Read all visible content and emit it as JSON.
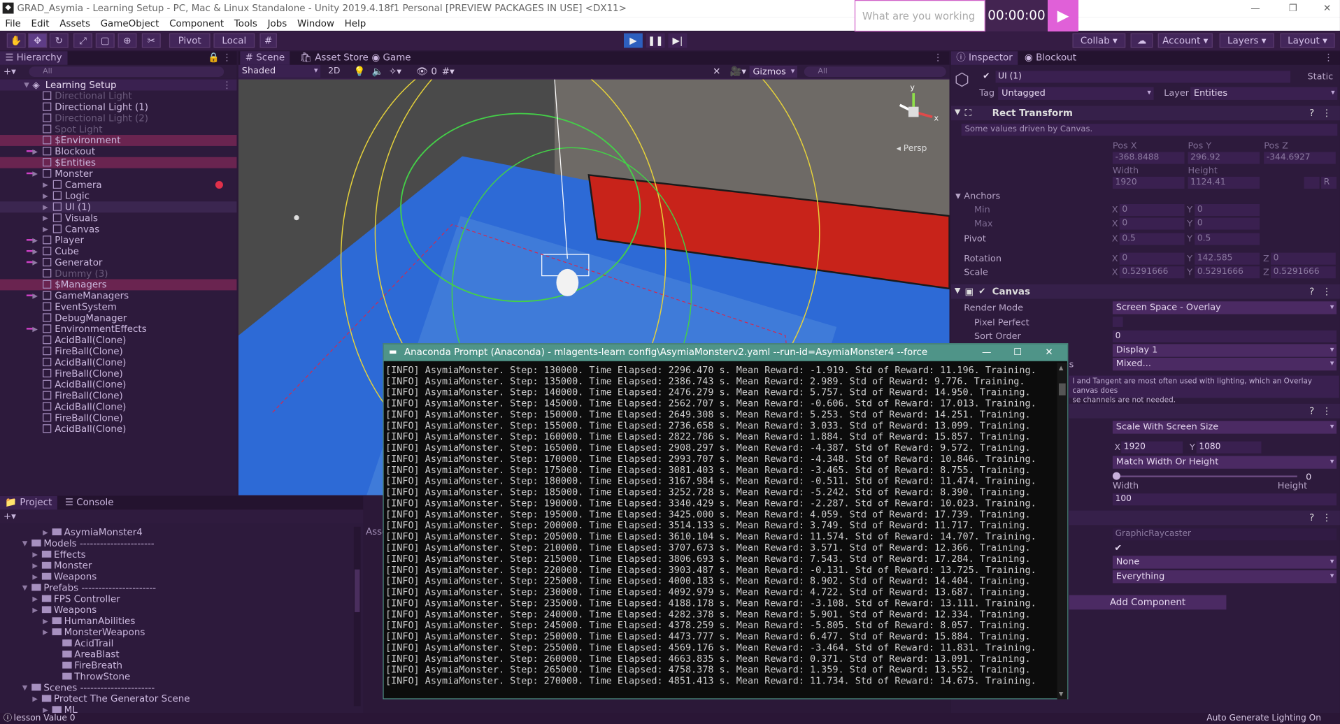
{
  "window": {
    "title": "GRAD_Asymia - Learning Setup - PC, Mac & Linux Standalone - Unity 2019.4.18f1 Personal [PREVIEW PACKAGES IN USE] <DX11>",
    "search_placeholder": "What are you working on?",
    "timer": "00:00:00"
  },
  "menu": [
    "File",
    "Edit",
    "Assets",
    "GameObject",
    "Component",
    "Tools",
    "Jobs",
    "Window",
    "Help"
  ],
  "toolbar": {
    "pivot": "Pivot",
    "local": "Local",
    "collab": "Collab",
    "account": "Account",
    "layers": "Layers",
    "layout": "Layout"
  },
  "hierarchy": {
    "tab": "Hierarchy",
    "search_placeholder": "All",
    "scene": "Learning Setup",
    "items": [
      {
        "label": "Directional Light",
        "style": "dim"
      },
      {
        "label": "Directional Light (1)",
        "style": "normal"
      },
      {
        "label": "Directional Light (2)",
        "style": "dim"
      },
      {
        "label": "Spot Light",
        "style": "dim"
      },
      {
        "label": "$Environment",
        "style": "hl"
      },
      {
        "label": "Blockout",
        "style": "normal"
      },
      {
        "label": "$Entities",
        "style": "hl"
      },
      {
        "label": "Monster",
        "style": "normal"
      },
      {
        "label": "Camera",
        "style": "child"
      },
      {
        "label": "Logic",
        "style": "child"
      },
      {
        "label": "UI (1)",
        "style": "childsel"
      },
      {
        "label": "Visuals",
        "style": "child"
      },
      {
        "label": "Canvas",
        "style": "child"
      },
      {
        "label": "Player",
        "style": "normal"
      },
      {
        "label": "Cube",
        "style": "normal"
      },
      {
        "label": "Generator",
        "style": "normal"
      },
      {
        "label": "Dummy (3)",
        "style": "dim"
      },
      {
        "label": "$Managers",
        "style": "hl"
      },
      {
        "label": "GameManagers",
        "style": "normal"
      },
      {
        "label": "EventSystem",
        "style": "normal"
      },
      {
        "label": "DebugManager",
        "style": "normal"
      },
      {
        "label": "EnvironmentEffects",
        "style": "normal"
      },
      {
        "label": "AcidBall(Clone)",
        "style": "normal"
      },
      {
        "label": "FireBall(Clone)",
        "style": "normal"
      },
      {
        "label": "AcidBall(Clone)",
        "style": "normal"
      },
      {
        "label": "FireBall(Clone)",
        "style": "normal"
      },
      {
        "label": "AcidBall(Clone)",
        "style": "normal"
      },
      {
        "label": "FireBall(Clone)",
        "style": "normal"
      },
      {
        "label": "AcidBall(Clone)",
        "style": "normal"
      },
      {
        "label": "FireBall(Clone)",
        "style": "normal"
      },
      {
        "label": "AcidBall(Clone)",
        "style": "normal"
      }
    ]
  },
  "scene": {
    "tabs": [
      "Scene",
      "Asset Store",
      "Game"
    ],
    "shading": "Shaded",
    "twod": "2D",
    "fx_count": "0",
    "gizmos": "Gizmos",
    "search_placeholder": "All",
    "persp": "Persp",
    "axis_x": "x",
    "axis_y": "y"
  },
  "project": {
    "tabs": [
      "Project",
      "Console"
    ],
    "partial_label": "Asse",
    "partial_label2": "Ac",
    "tree": [
      {
        "label": "AsymiaMonster4",
        "depth": 3,
        "sep": false
      },
      {
        "label": "Models",
        "depth": 1,
        "sep": true
      },
      {
        "label": "Effects",
        "depth": 2,
        "sep": false
      },
      {
        "label": "Monster",
        "depth": 2,
        "sep": false
      },
      {
        "label": "Weapons",
        "depth": 2,
        "sep": false
      },
      {
        "label": "Prefabs",
        "depth": 1,
        "sep": true
      },
      {
        "label": "FPS Controller",
        "depth": 2,
        "sep": false
      },
      {
        "label": "Weapons",
        "depth": 2,
        "sep": false
      },
      {
        "label": "HumanAbilities",
        "depth": 3,
        "sep": false
      },
      {
        "label": "MonsterWeapons",
        "depth": 3,
        "sep": false
      },
      {
        "label": "AcidTrail",
        "depth": 4,
        "sep": false
      },
      {
        "label": "AreaBlast",
        "depth": 4,
        "sep": false
      },
      {
        "label": "FireBreath",
        "depth": 4,
        "sep": false
      },
      {
        "label": "ThrowStone",
        "depth": 4,
        "sep": false
      },
      {
        "label": "Scenes",
        "depth": 1,
        "sep": true
      },
      {
        "label": "Protect The Generator Scene",
        "depth": 2,
        "sep": false
      },
      {
        "label": "ML",
        "depth": 3,
        "sep": false
      }
    ]
  },
  "inspector": {
    "tabs": [
      "Inspector",
      "Blockout"
    ],
    "object_name": "UI (1)",
    "static": "Static",
    "tag_label": "Tag",
    "tag": "Untagged",
    "layer_label": "Layer",
    "layer": "Entities",
    "rect_transform": "Rect Transform",
    "driven_note": "Some values driven by Canvas.",
    "pos_headers": [
      "Pos X",
      "Pos Y",
      "Pos Z"
    ],
    "pos_values": [
      "-368.8488",
      "296.92",
      "-344.6927"
    ],
    "size_headers": [
      "Width",
      "Height"
    ],
    "size_values": [
      "1920",
      "1124.41"
    ],
    "anchors": "Anchors",
    "min": "Min",
    "max": "Max",
    "anchor_min": [
      "0",
      "0"
    ],
    "anchor_max": [
      "0",
      "0"
    ],
    "pivot_label": "Pivot",
    "pivot": [
      "0.5",
      "0.5"
    ],
    "rotation_label": "Rotation",
    "rotation": [
      "0",
      "142.585",
      "0"
    ],
    "scale_label": "Scale",
    "scale": [
      "0.5291666",
      "0.5291666",
      "0.5291666"
    ],
    "canvas": "Canvas",
    "render_mode_label": "Render Mode",
    "render_mode": "Screen Space - Overlay",
    "pixel_perfect": "Pixel Perfect",
    "sort_order_label": "Sort Order",
    "sort_order": "0",
    "target_display": "Display 1",
    "mixed": "Mixed...",
    "mixed_label_tail": "s",
    "normal_note_1": "l and Tangent are most often used with lighting, which an Overlay canvas does",
    "normal_note_2": "se channels are not needed.",
    "ui_scale_mode": "Scale With Screen Size",
    "ref_x": "1920",
    "ref_y": "1080",
    "screen_match": "Match Width Or Height",
    "match_zero": "0",
    "width_lbl": "Width",
    "height_lbl": "Height",
    "ref_ppu": "100",
    "raycaster_script": "GraphicRaycaster",
    "blocking_objects": "None",
    "blocking_mask": "Everything",
    "add_component": "Add Component",
    "axis_letters": [
      "X",
      "Y",
      "Z"
    ]
  },
  "terminal": {
    "title": "Anaconda Prompt (Anaconda) - mlagents-learn  config\\AsymiaMonsterv2.yaml --run-id=AsymiaMonster4 --force",
    "lines": [
      "[INFO] AsymiaMonster. Step: 130000. Time Elapsed: 2296.470 s. Mean Reward: -1.919. Std of Reward: 11.196. Training.",
      "[INFO] AsymiaMonster. Step: 135000. Time Elapsed: 2386.743 s. Mean Reward: 2.989. Std of Reward: 9.776. Training.",
      "[INFO] AsymiaMonster. Step: 140000. Time Elapsed: 2476.279 s. Mean Reward: 5.757. Std of Reward: 14.950. Training.",
      "[INFO] AsymiaMonster. Step: 145000. Time Elapsed: 2562.707 s. Mean Reward: -0.606. Std of Reward: 17.013. Training.",
      "[INFO] AsymiaMonster. Step: 150000. Time Elapsed: 2649.308 s. Mean Reward: 5.253. Std of Reward: 14.251. Training.",
      "[INFO] AsymiaMonster. Step: 155000. Time Elapsed: 2736.658 s. Mean Reward: 3.033. Std of Reward: 13.099. Training.",
      "[INFO] AsymiaMonster. Step: 160000. Time Elapsed: 2822.786 s. Mean Reward: 1.884. Std of Reward: 15.857. Training.",
      "[INFO] AsymiaMonster. Step: 165000. Time Elapsed: 2908.297 s. Mean Reward: -4.387. Std of Reward: 9.572. Training.",
      "[INFO] AsymiaMonster. Step: 170000. Time Elapsed: 2993.707 s. Mean Reward: -4.348. Std of Reward: 10.846. Training.",
      "[INFO] AsymiaMonster. Step: 175000. Time Elapsed: 3081.403 s. Mean Reward: -3.465. Std of Reward: 8.755. Training.",
      "[INFO] AsymiaMonster. Step: 180000. Time Elapsed: 3167.984 s. Mean Reward: -0.511. Std of Reward: 11.474. Training.",
      "[INFO] AsymiaMonster. Step: 185000. Time Elapsed: 3252.728 s. Mean Reward: -5.242. Std of Reward: 8.390. Training.",
      "[INFO] AsymiaMonster. Step: 190000. Time Elapsed: 3340.429 s. Mean Reward: -2.287. Std of Reward: 10.023. Training.",
      "[INFO] AsymiaMonster. Step: 195000. Time Elapsed: 3425.000 s. Mean Reward: 4.059. Std of Reward: 17.739. Training.",
      "[INFO] AsymiaMonster. Step: 200000. Time Elapsed: 3514.133 s. Mean Reward: 3.749. Std of Reward: 11.717. Training.",
      "[INFO] AsymiaMonster. Step: 205000. Time Elapsed: 3610.104 s. Mean Reward: 11.574. Std of Reward: 14.707. Training.",
      "[INFO] AsymiaMonster. Step: 210000. Time Elapsed: 3707.673 s. Mean Reward: 3.571. Std of Reward: 12.366. Training.",
      "[INFO] AsymiaMonster. Step: 215000. Time Elapsed: 3806.693 s. Mean Reward: 7.543. Std of Reward: 17.284. Training.",
      "[INFO] AsymiaMonster. Step: 220000. Time Elapsed: 3903.487 s. Mean Reward: -0.131. Std of Reward: 13.725. Training.",
      "[INFO] AsymiaMonster. Step: 225000. Time Elapsed: 4000.183 s. Mean Reward: 8.902. Std of Reward: 14.404. Training.",
      "[INFO] AsymiaMonster. Step: 230000. Time Elapsed: 4092.979 s. Mean Reward: 4.722. Std of Reward: 13.687. Training.",
      "[INFO] AsymiaMonster. Step: 235000. Time Elapsed: 4188.178 s. Mean Reward: -3.108. Std of Reward: 13.111. Training.",
      "[INFO] AsymiaMonster. Step: 240000. Time Elapsed: 4282.378 s. Mean Reward: 5.901. Std of Reward: 12.334. Training.",
      "[INFO] AsymiaMonster. Step: 245000. Time Elapsed: 4378.259 s. Mean Reward: -5.805. Std of Reward: 8.057. Training.",
      "[INFO] AsymiaMonster. Step: 250000. Time Elapsed: 4473.777 s. Mean Reward: 6.477. Std of Reward: 15.884. Training.",
      "[INFO] AsymiaMonster. Step: 255000. Time Elapsed: 4569.176 s. Mean Reward: -3.464. Std of Reward: 11.831. Training.",
      "[INFO] AsymiaMonster. Step: 260000. Time Elapsed: 4663.835 s. Mean Reward: 0.371. Std of Reward: 13.091. Training.",
      "[INFO] AsymiaMonster. Step: 265000. Time Elapsed: 4758.378 s. Mean Reward: 1.359. Std of Reward: 13.552. Training.",
      "[INFO] AsymiaMonster. Step: 270000. Time Elapsed: 4851.413 s. Mean Reward: 11.734. Std of Reward: 14.675. Training."
    ]
  },
  "status": {
    "left": "lesson Value 0",
    "right": "Auto Generate Lighting On"
  },
  "colors": {
    "panel_bg": "#2d1a3c",
    "accent": "#e060d8",
    "highlight_row": "#6a2450",
    "terminal_title": "#4f9488"
  }
}
